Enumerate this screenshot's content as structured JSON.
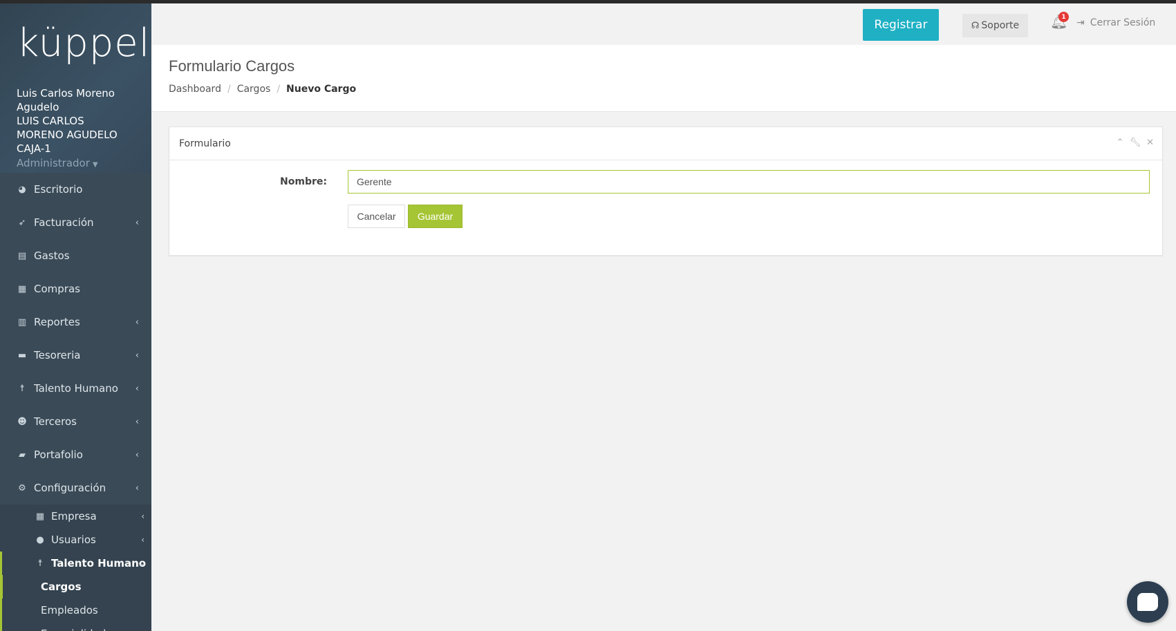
{
  "app": {
    "logo_text": "küppel",
    "logo_tm": "™"
  },
  "user": {
    "line1": "Luis Carlos Moreno",
    "line2": "Agudelo",
    "line3": "LUIS CARLOS",
    "line4": "MORENO AGUDELO",
    "line5": "CAJA-1",
    "role": "Administrador"
  },
  "sidebar": {
    "items": [
      {
        "label": "Escritorio",
        "icon": "pie-chart-icon"
      },
      {
        "label": "Facturación",
        "icon": "paper-plane-icon"
      },
      {
        "label": "Gastos",
        "icon": "document-icon"
      },
      {
        "label": "Compras",
        "icon": "boxes-icon"
      },
      {
        "label": "Reportes",
        "icon": "bar-chart-icon"
      },
      {
        "label": "Tesoreria",
        "icon": "wallet-icon"
      },
      {
        "label": "Talento Humano",
        "icon": "person-icon"
      },
      {
        "label": "Terceros",
        "icon": "users-icon"
      },
      {
        "label": "Portafolio",
        "icon": "briefcase-icon"
      },
      {
        "label": "Configuración",
        "icon": "gear-icon"
      }
    ],
    "config_sub": [
      {
        "label": "Empresa",
        "icon": "building-icon"
      },
      {
        "label": "Usuarios",
        "icon": "user-icon"
      },
      {
        "label": "Talento Humano",
        "icon": "person-icon"
      }
    ],
    "talento_sub": [
      {
        "label": "Cargos"
      },
      {
        "label": "Empleados"
      },
      {
        "label": "Especialidades"
      }
    ]
  },
  "topbar": {
    "register_label": "Registrar",
    "support_label": "Soporte",
    "notifications_count": "1",
    "logout_label": "Cerrar Sesión"
  },
  "header": {
    "title": "Formulario Cargos",
    "breadcrumb": [
      "Dashboard",
      "Cargos",
      "Nuevo Cargo"
    ]
  },
  "panel": {
    "title": "Formulario",
    "name_label": "Nombre:",
    "name_value": "Gerente",
    "cancel_label": "Cancelar",
    "save_label": "Guardar"
  },
  "colors": {
    "sidebar_bg": "#3a4a57",
    "accent_teal": "#1fb0c4",
    "accent_green": "#a6c535",
    "badge_red": "#e53935"
  }
}
